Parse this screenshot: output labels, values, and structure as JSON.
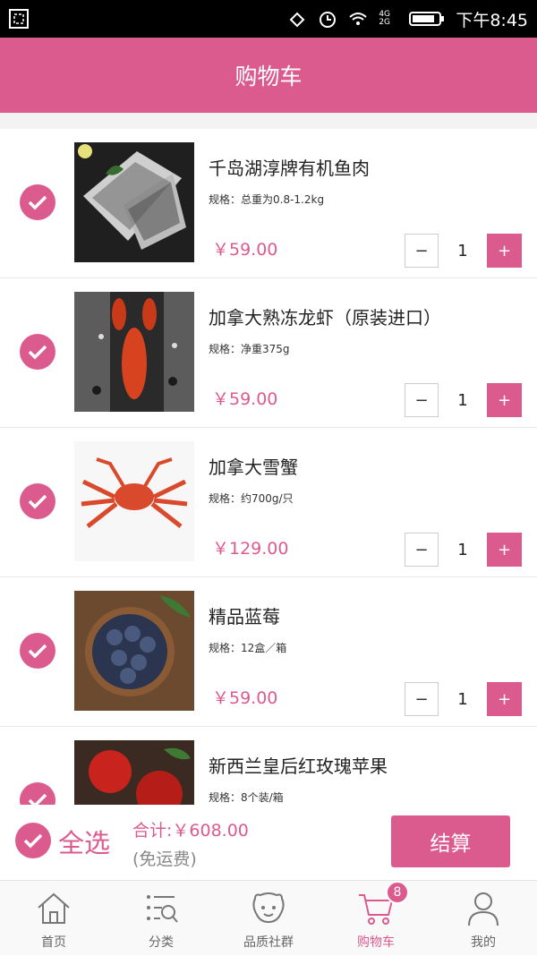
{
  "status_bar": {
    "time": "下午8:45",
    "network": "4G 2G"
  },
  "header": {
    "title": "购物车"
  },
  "cart": {
    "items": [
      {
        "name": "千岛湖淳牌有机鱼肉",
        "spec": "规格：总重为0.8-1.2kg",
        "price": "￥59.00",
        "quantity": "1",
        "minus": "−",
        "plus": "+",
        "image_icon": "fish-fillet-image"
      },
      {
        "name": "加拿大熟冻龙虾（原装进口）",
        "spec": "规格：净重375g",
        "price": "￥59.00",
        "quantity": "1",
        "minus": "−",
        "plus": "+",
        "image_icon": "lobster-image"
      },
      {
        "name": "加拿大雪蟹",
        "spec": "规格：约700g/只",
        "price": "￥129.00",
        "quantity": "1",
        "minus": "−",
        "plus": "+",
        "image_icon": "snow-crab-image"
      },
      {
        "name": "精品蓝莓",
        "spec": "规格：12盒／箱",
        "price": "￥59.00",
        "quantity": "1",
        "minus": "−",
        "plus": "+",
        "image_icon": "blueberries-image"
      },
      {
        "name": "新西兰皇后红玫瑰苹果",
        "spec": "规格：8个装/箱",
        "image_icon": "red-apples-image"
      }
    ]
  },
  "checkout": {
    "select_all": "全选",
    "total": "合计:￥608.00",
    "shipping": "(免运费)",
    "settle_button": "结算"
  },
  "tabbar": {
    "tabs": [
      {
        "label": "首页",
        "icon": "home-icon"
      },
      {
        "label": "分类",
        "icon": "category-icon"
      },
      {
        "label": "品质社群",
        "icon": "community-icon"
      },
      {
        "label": "购物车",
        "icon": "cart-icon",
        "badge": "8",
        "active": true
      },
      {
        "label": "我的",
        "icon": "user-icon"
      }
    ]
  },
  "colors": {
    "accent": "#dc5b8e",
    "status_bar": "#000000",
    "divider": "#e8e8e8"
  }
}
